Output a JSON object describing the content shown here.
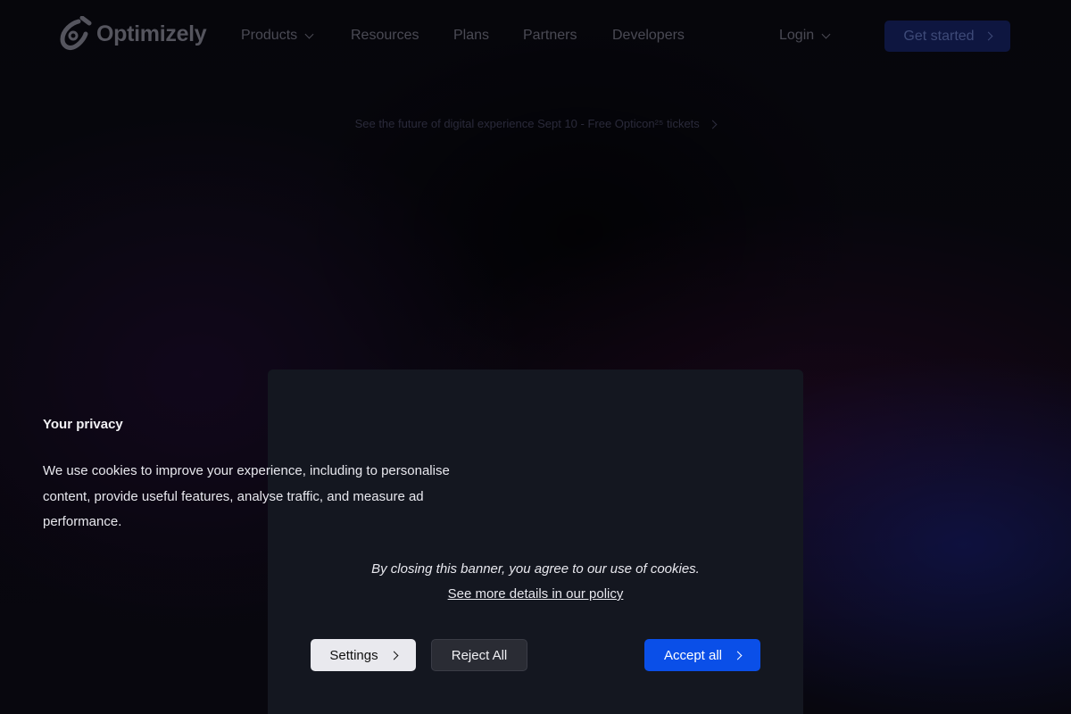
{
  "header": {
    "logo_text": "Optimizely",
    "nav": {
      "products": "Products",
      "resources": "Resources",
      "plans": "Plans",
      "partners": "Partners",
      "developers": "Developers"
    },
    "login": "Login",
    "cta": "Get started"
  },
  "announcement": {
    "text": "See the future of digital experience Sept 10 - Free Opticon²⁵ tickets"
  },
  "cookie_modal": {
    "title": "Your privacy",
    "body": "We use cookies to improve your experience, including to personalise content, provide useful features, analyse traffic, and measure ad performance.",
    "note": "By closing this banner, you agree to our use of cookies.",
    "policy_link": "See more details in our policy",
    "buttons": {
      "settings": "Settings",
      "reject": "Reject All",
      "accept": "Accept all"
    }
  },
  "colors": {
    "accent": "#0a4fe8",
    "modal_bg": "#141720"
  },
  "icons": [
    "optimizely-logo-icon",
    "chevron-down-icon",
    "chevron-right-icon"
  ]
}
